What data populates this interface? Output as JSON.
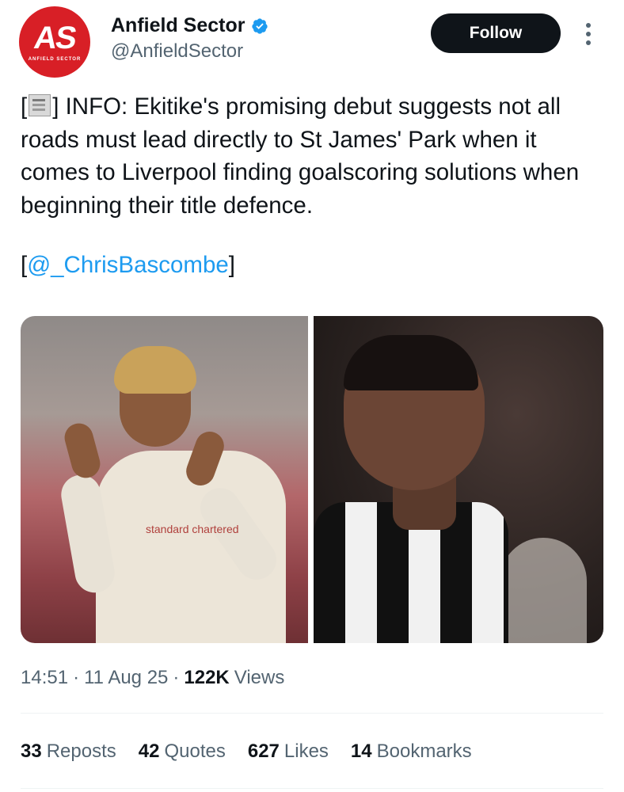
{
  "author": {
    "avatar_text": "AS",
    "avatar_subtext": "ANFIELD SECTOR",
    "display_name": "Anfield Sector",
    "handle": "@AnfieldSector"
  },
  "follow_label": "Follow",
  "tweet": {
    "open_bracket": "[",
    "after_glyph": "] INFO: Ekitike's promising debut suggests not all roads must lead directly to St James' Park when it comes to Liverpool finding goalscoring solutions when beginning their title defence.",
    "mention_open": "[",
    "mention": "@_ChrisBascombe",
    "mention_close": "]"
  },
  "media": {
    "left_sponsor": "standard chartered"
  },
  "meta": {
    "time": "14:51",
    "date": "11 Aug 25",
    "views_count": "122K",
    "views_label": "Views"
  },
  "stats": [
    {
      "count": "33",
      "label": "Reposts"
    },
    {
      "count": "42",
      "label": "Quotes"
    },
    {
      "count": "627",
      "label": "Likes"
    },
    {
      "count": "14",
      "label": "Bookmarks"
    }
  ],
  "colors": {
    "accent": "#1d9bf0",
    "brand_red": "#d81f26",
    "text": "#0f1419",
    "muted": "#536471"
  }
}
